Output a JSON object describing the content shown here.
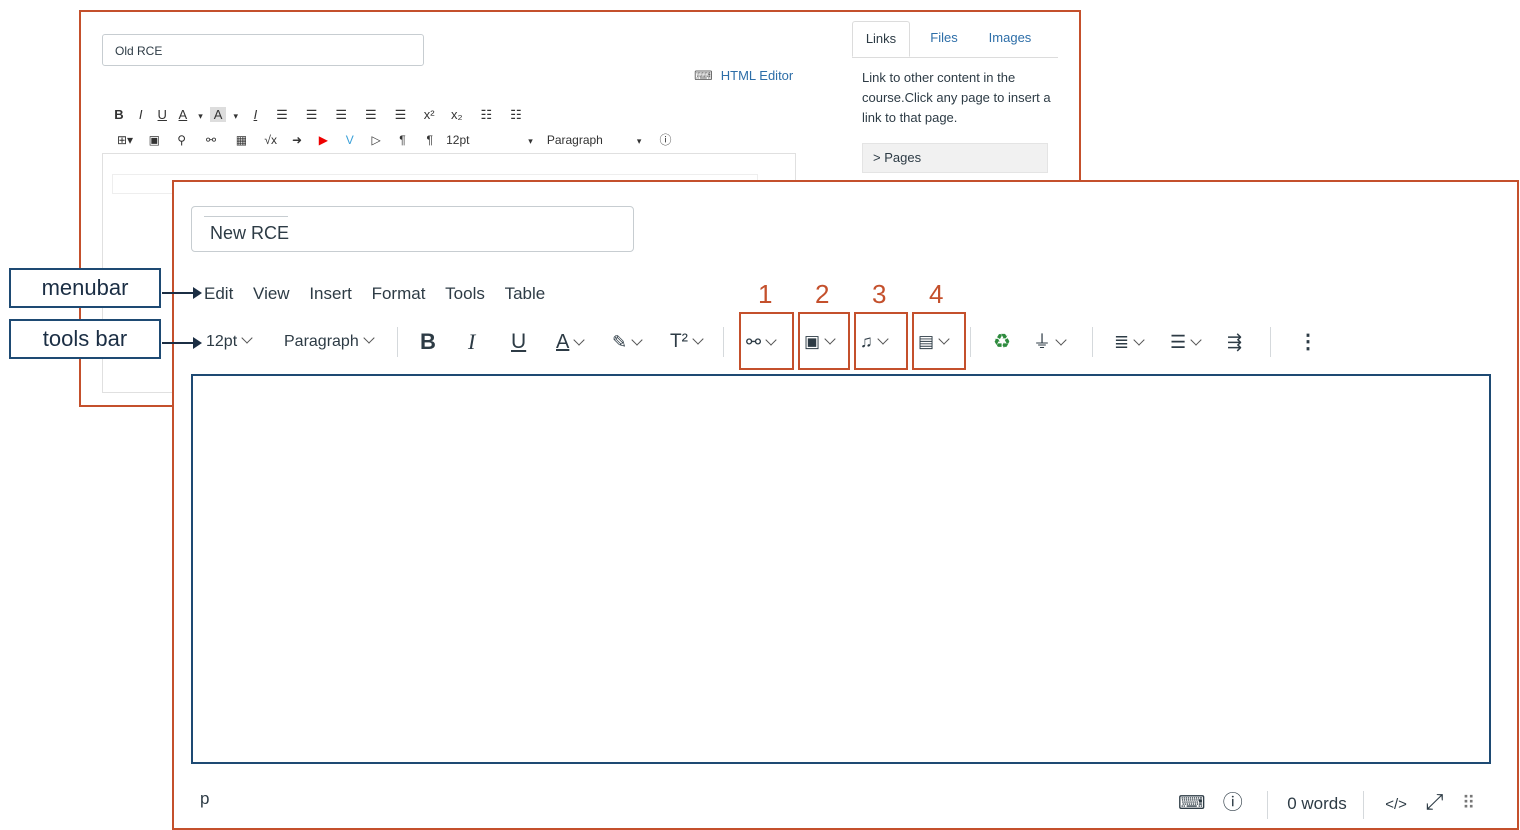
{
  "old_rce": {
    "title_value": "Old RCE",
    "html_editor_label": "HTML Editor",
    "toolbar_row1": [
      "B",
      "I",
      "U",
      "A",
      "▾",
      "A",
      "▾",
      "Ix",
      "≡",
      "≡",
      "≡",
      "≡",
      "≡",
      "x²",
      "x₂",
      "☰",
      "☰"
    ],
    "toolbar_row2": [
      "⊞▾",
      "▣",
      "🔗",
      "⛓",
      "▦",
      "√x",
      "➜",
      "▶",
      "V",
      "▷",
      "¶",
      "¶‹",
      "12pt",
      "▾ Paragraph",
      "▾",
      "ⓘ"
    ],
    "font_size": "12pt",
    "block_format": "Paragraph",
    "tabs": [
      "Links",
      "Files",
      "Images"
    ],
    "links_description": "Link to other content in the course.Click any page to insert a link to that page.",
    "pages_label": "> Pages"
  },
  "new_rce": {
    "title_value": "New RCE",
    "menubar": [
      "Edit",
      "View",
      "Insert",
      "Format",
      "Tools",
      "Table"
    ],
    "toolbar": {
      "font_size": "12pt",
      "block_format": "Paragraph",
      "bold": "B",
      "italic": "I",
      "underline": "U",
      "text_color": "A",
      "superscript": "T²"
    },
    "numbered_groups": [
      "1",
      "2",
      "3",
      "4"
    ],
    "status": {
      "element_path": "p",
      "word_count": "0 words",
      "html_toggle": "</>"
    }
  },
  "callouts": {
    "menubar": "menubar",
    "tools_bar": "tools bar"
  },
  "colors": {
    "frame_border": "#c4502c",
    "callout_border": "#1e4a73",
    "link_blue": "#2d6ea8",
    "text": "#2d3b45"
  }
}
